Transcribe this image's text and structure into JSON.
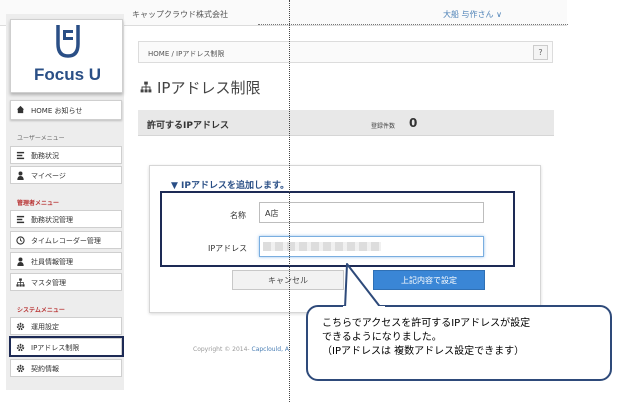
{
  "header": {
    "company": "キャップクラウド株式会社",
    "user": "大船 与作さん ∨"
  },
  "sidebar": {
    "logo_text": "Focus U",
    "home": "HOME お知らせ",
    "user_menu_title": "ユーザーメニュー",
    "user_menu": [
      "勤務状況",
      "マイページ"
    ],
    "admin_menu_title": "管理者メニュー",
    "admin_menu": [
      "勤務状況管理",
      "タイムレコーダー管理",
      "社員情報管理",
      "マスタ管理"
    ],
    "system_menu_title": "システムメニュー",
    "system_menu": [
      "運用設定",
      "IPアドレス制限",
      "契約情報"
    ]
  },
  "breadcrumb": {
    "text": "HOME / IPアドレス制限",
    "help": "?"
  },
  "page": {
    "title": "IPアドレス制限"
  },
  "list": {
    "title": "許可するIPアドレス",
    "count_label": "登録件数",
    "count": "0"
  },
  "form": {
    "heading": "▼ IPアドレスを追加します。",
    "name_label": "名称",
    "name_value": "A店",
    "ip_label": "IPアドレス",
    "cancel": "キャンセル",
    "submit": "上記内容で設定"
  },
  "footer": {
    "copyright_prefix": "Copyright © 2014-",
    "copyright_brand": "Capclould, A"
  },
  "callout": {
    "line1": "こちらでアクセスを許可するIPアドレスが設定",
    "line2": "できるようになりました。",
    "line3": "（IPアドレスは 複数アドレス設定できます）"
  },
  "colors": {
    "brand": "#2a4f86",
    "accent": "#3a86d6",
    "highlight_border": "#1d2a55"
  }
}
